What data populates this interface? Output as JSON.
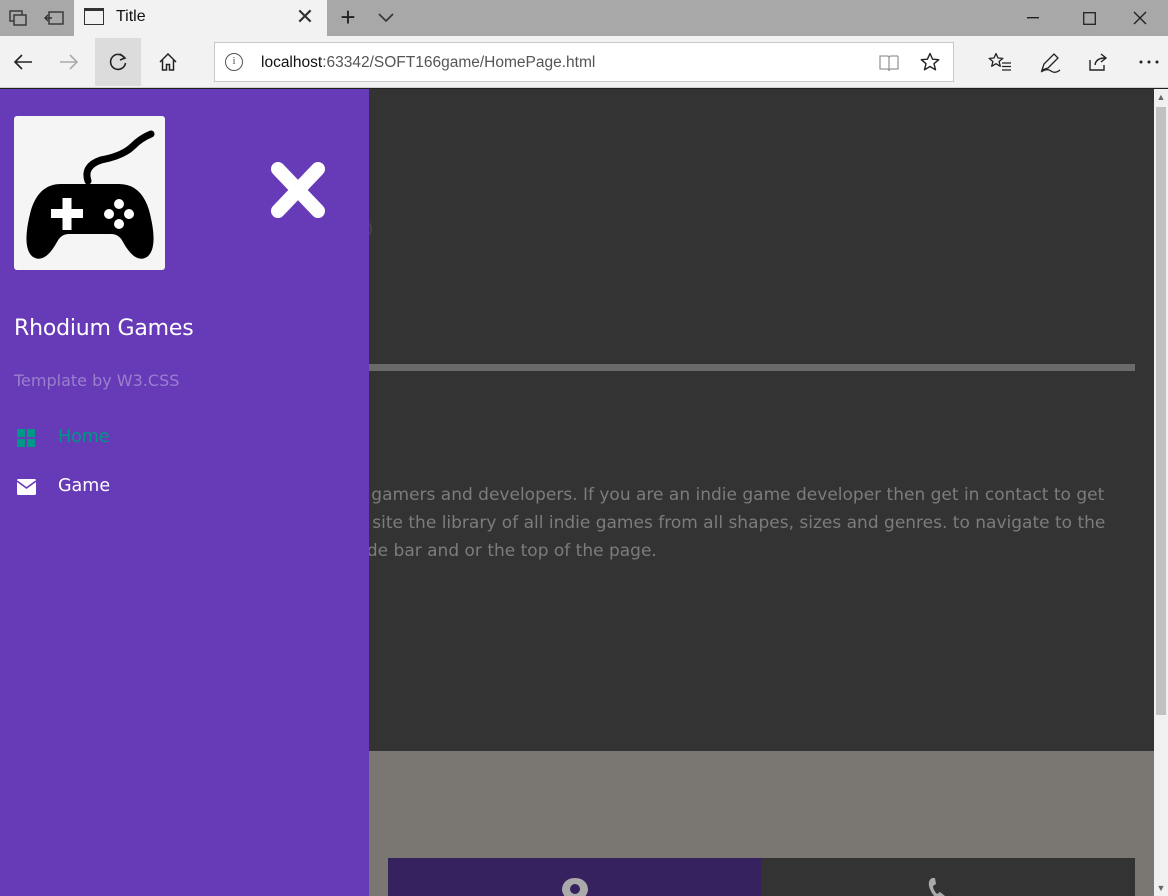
{
  "browser": {
    "tab_title": "Title",
    "tab_close_glyph": "✕",
    "new_tab_glyph": "+",
    "url_host": "localhost",
    "url_rest": ":63342/SOFT166game/HomePage.html",
    "info_glyph": "i"
  },
  "sidebar": {
    "brand": "Rhodium Games",
    "tagline": "Template by W3.CSS",
    "items": [
      {
        "label": "Home",
        "icon": "grid-icon",
        "active": true
      },
      {
        "label": "Game",
        "icon": "envelope-icon",
        "active": false
      }
    ],
    "colors": {
      "background": "#673ab7",
      "active_item": "#009688",
      "tagline": "#9a7fcf"
    }
  },
  "main": {
    "about_lines": [
      "te for gamers and developers. If you are an indie game developer then get in contact to get",
      "e this site the library of all indie games from all shapes, sizes and genres. to navigate to the",
      " the side bar and or the top of the page."
    ],
    "colors": {
      "background": "#333333",
      "contact_band": "#7a7671",
      "card_purple": "#35225e"
    }
  }
}
